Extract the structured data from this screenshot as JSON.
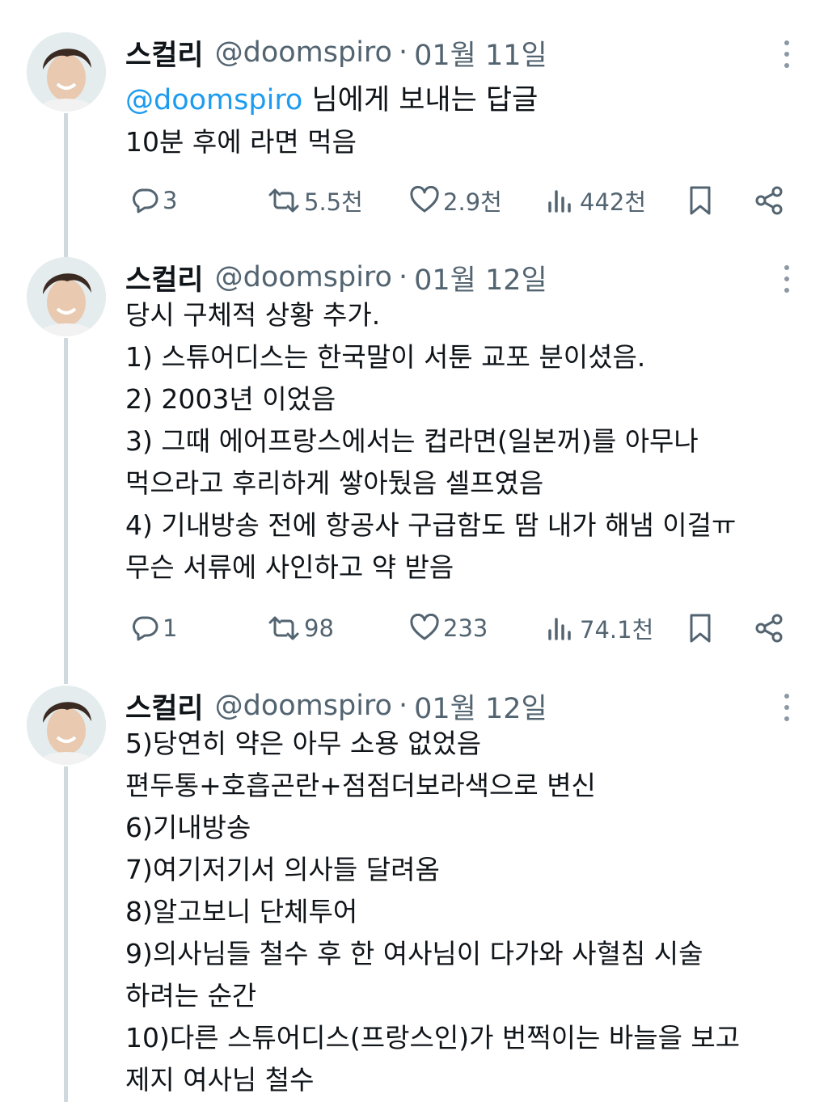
{
  "tweets": [
    {
      "author_name": "스컬리",
      "handle": "@doomspiro",
      "separator": "·",
      "date": "01월 11일",
      "reply_to_mention": "@doomspiro",
      "reply_to_suffix": " 님에게 보내는 답글",
      "lines": [
        "10분 후에 라면 먹음"
      ],
      "stats": {
        "replies": "3",
        "reposts": "5.5천",
        "likes": "2.9천",
        "views": "442천"
      }
    },
    {
      "author_name": "스컬리",
      "handle": "@doomspiro",
      "separator": "·",
      "date": "01월 12일",
      "lines": [
        "당시 구체적 상황 추가.",
        "1) 스튜어디스는 한국말이 서툰 교포 분이셨음.",
        "2) 2003년 이었음",
        "3) 그때 에어프랑스에서는 컵라면(일본꺼)를 아무나",
        "먹으라고 후리하게 쌓아뒀음 셀프였음",
        "4) 기내방송 전에 항공사 구급함도 땀  내가 해냄 이걸ㅠ",
        "무슨 서류에 사인하고 약 받음"
      ],
      "stats": {
        "replies": "1",
        "reposts": "98",
        "likes": "233",
        "views": "74.1천"
      }
    },
    {
      "author_name": "스컬리",
      "handle": "@doomspiro",
      "separator": "·",
      "date": "01월 12일",
      "lines": [
        "5)당연히 약은 아무 소용 없었음",
        "편두통+호흡곤란+점점더보라색으로 변신",
        "6)기내방송",
        "7)여기저기서 의사들 달려옴",
        "8)알고보니 단체투어",
        "9)의사님들 철수 후 한 여사님이 다가와 사혈침 시술",
        "하려는 순간",
        "10)다른 스튜어디스(프랑스인)가 번쩍이는 바늘을 보고",
        "제지 여사님 철수"
      ]
    }
  ],
  "colors": {
    "text": "#0f1419",
    "secondary": "#536471",
    "accent": "#1d9bf0",
    "thread_line": "#cfd9de"
  },
  "icons": [
    "reply-icon",
    "repost-icon",
    "like-icon",
    "views-icon",
    "bookmark-icon",
    "share-icon",
    "more-icon"
  ]
}
